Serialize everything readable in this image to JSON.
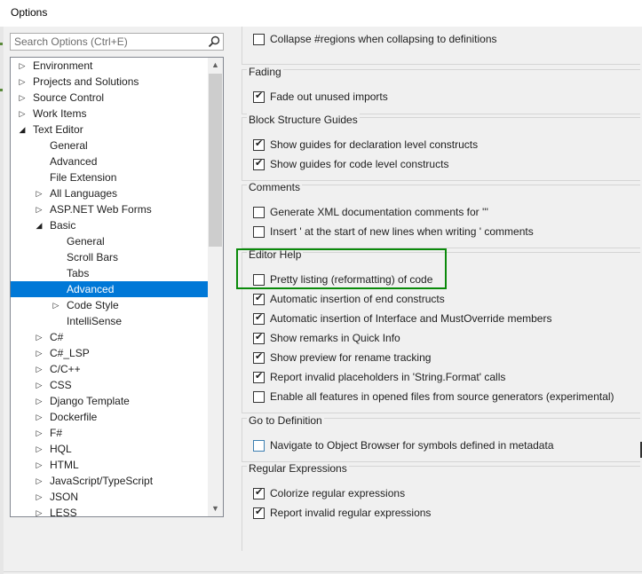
{
  "window": {
    "title": "Options"
  },
  "search": {
    "placeholder": "Search Options (Ctrl+E)",
    "icon": "search-icon"
  },
  "tree": {
    "items": [
      {
        "label": "Environment",
        "expander": "right",
        "indent": 0
      },
      {
        "label": "Projects and Solutions",
        "expander": "right",
        "indent": 0
      },
      {
        "label": "Source Control",
        "expander": "right",
        "indent": 0
      },
      {
        "label": "Work Items",
        "expander": "right",
        "indent": 0
      },
      {
        "label": "Text Editor",
        "expander": "down",
        "indent": 0
      },
      {
        "label": "General",
        "expander": "none",
        "indent": 1
      },
      {
        "label": "Advanced",
        "expander": "none",
        "indent": 1
      },
      {
        "label": "File Extension",
        "expander": "none",
        "indent": 1
      },
      {
        "label": "All Languages",
        "expander": "right",
        "indent": 1
      },
      {
        "label": "ASP.NET Web Forms",
        "expander": "right",
        "indent": 1
      },
      {
        "label": "Basic",
        "expander": "down",
        "indent": 1
      },
      {
        "label": "General",
        "expander": "none",
        "indent": 2
      },
      {
        "label": "Scroll Bars",
        "expander": "none",
        "indent": 2
      },
      {
        "label": "Tabs",
        "expander": "none",
        "indent": 2
      },
      {
        "label": "Advanced",
        "expander": "none",
        "indent": 2,
        "selected": true
      },
      {
        "label": "Code Style",
        "expander": "right",
        "indent": 2
      },
      {
        "label": "IntelliSense",
        "expander": "none",
        "indent": 2
      },
      {
        "label": "C#",
        "expander": "right",
        "indent": 1
      },
      {
        "label": "C#_LSP",
        "expander": "right",
        "indent": 1
      },
      {
        "label": "C/C++",
        "expander": "right",
        "indent": 1
      },
      {
        "label": "CSS",
        "expander": "right",
        "indent": 1
      },
      {
        "label": "Django Template",
        "expander": "right",
        "indent": 1
      },
      {
        "label": "Dockerfile",
        "expander": "right",
        "indent": 1
      },
      {
        "label": "F#",
        "expander": "right",
        "indent": 1
      },
      {
        "label": "HQL",
        "expander": "right",
        "indent": 1
      },
      {
        "label": "HTML",
        "expander": "right",
        "indent": 1
      },
      {
        "label": "JavaScript/TypeScript",
        "expander": "right",
        "indent": 1
      },
      {
        "label": "JSON",
        "expander": "right",
        "indent": 1
      },
      {
        "label": "LESS",
        "expander": "right",
        "indent": 1
      }
    ]
  },
  "groups": [
    {
      "title": "",
      "options": [
        {
          "text": "Collapse #regions when collapsing to definitions",
          "checked": false
        }
      ]
    },
    {
      "title": "Fading",
      "options": [
        {
          "text": "Fade out unused imports",
          "checked": true
        }
      ]
    },
    {
      "title": "Block Structure Guides",
      "options": [
        {
          "text": "Show guides for declaration level constructs",
          "checked": true
        },
        {
          "text": "Show guides for code level constructs",
          "checked": true
        }
      ]
    },
    {
      "title": "Comments",
      "options": [
        {
          "text": "Generate XML documentation comments for '''",
          "checked": false
        },
        {
          "text": "Insert ' at the start of new lines when writing ' comments",
          "checked": false
        }
      ]
    },
    {
      "title": "Editor Help",
      "options": [
        {
          "text": "Pretty listing (reformatting) of code",
          "checked": false
        },
        {
          "text": "Automatic insertion of end constructs",
          "checked": true
        },
        {
          "text": "Automatic insertion of Interface and MustOverride members",
          "checked": true
        },
        {
          "text": "Show remarks in Quick Info",
          "checked": true
        },
        {
          "text": "Show preview for rename tracking",
          "checked": true
        },
        {
          "text": "Report invalid placeholders in 'String.Format' calls",
          "checked": true
        },
        {
          "text": "Enable all features in opened files from source generators (experimental)",
          "checked": false
        }
      ]
    },
    {
      "title": "Go to Definition",
      "options": [
        {
          "text": "Navigate to Object Browser for symbols defined in metadata",
          "checked": false,
          "focused": true
        }
      ]
    },
    {
      "title": "Regular Expressions",
      "options": [
        {
          "text": "Colorize regular expressions",
          "checked": true
        },
        {
          "text": "Report invalid regular expressions",
          "checked": true
        }
      ]
    }
  ],
  "colors": {
    "selection": "#0078d7",
    "highlight_border": "#0a8a0a"
  }
}
